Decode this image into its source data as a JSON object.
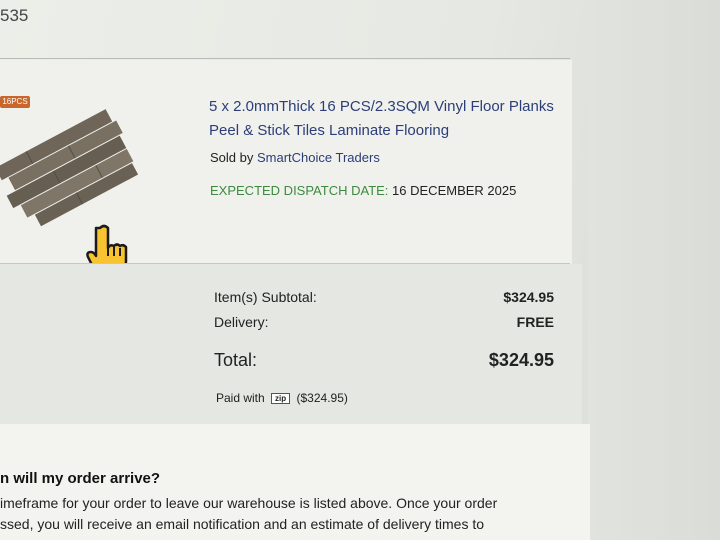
{
  "order": {
    "number_fragment": "535"
  },
  "product": {
    "badge": "16PCS",
    "title": "5 x 2.0mmThick 16 PCS/2.3SQM Vinyl Floor Planks Peel & Stick Tiles Laminate Flooring",
    "sold_by_prefix": "Sold by",
    "seller": "SmartChoice Traders",
    "dispatch_label": "EXPECTED DISPATCH DATE:",
    "dispatch_date": "16 DECEMBER 2025"
  },
  "summary": {
    "subtotal_label": "Item(s) Subtotal:",
    "subtotal_value": "$324.95",
    "delivery_label": "Delivery:",
    "delivery_value": "FREE",
    "total_label": "Total:",
    "total_value": "$324.95",
    "paid_prefix": "Paid with",
    "paid_logo": "zip",
    "paid_amount": "($324.95)"
  },
  "info": {
    "question": "n will my order arrive?",
    "line1": "imeframe for your order to leave our warehouse is listed above. Once your order",
    "line2": "ssed, you will receive an email notification and an estimate of delivery times to"
  }
}
